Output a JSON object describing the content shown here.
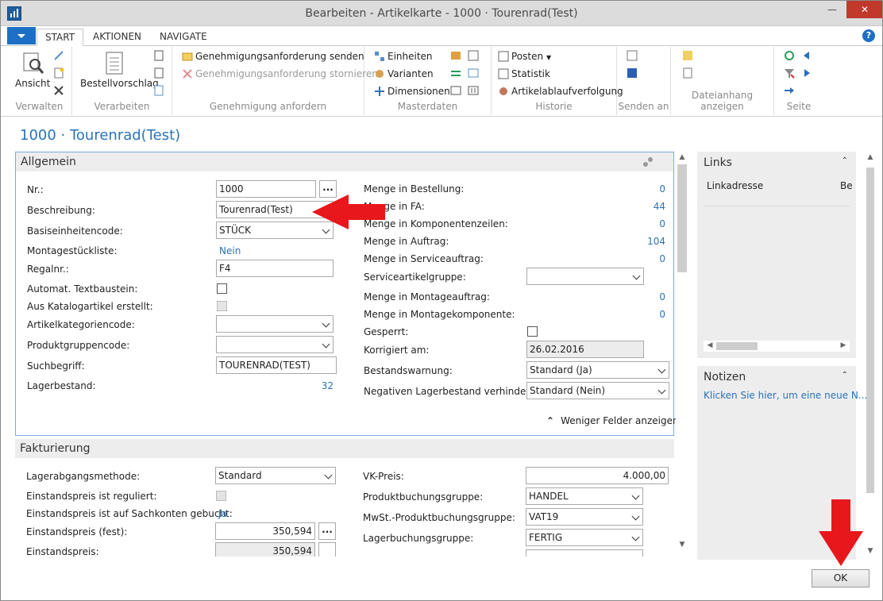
{
  "window": {
    "title": "Bearbeiten - Artikelkarte - 1000 · Tourenrad(Test)",
    "minimize_glyph": "—",
    "close_glyph": "✕"
  },
  "ribbon": {
    "tabs": [
      "START",
      "AKTIONEN",
      "NAVIGATE"
    ],
    "help_glyph": "?",
    "groups": {
      "verwalten": {
        "label": "Verwalten",
        "ansicht": "Ansicht"
      },
      "verarbeiten": {
        "label": "Verarbeiten",
        "bestellvorschlag": "Bestellvorschlag"
      },
      "genehmigung": {
        "label": "Genehmigung anfordern",
        "senden": "Genehmigungsanforderung senden",
        "stornieren": "Genehmigungsanforderung stornieren"
      },
      "masterdaten": {
        "label": "Masterdaten",
        "einheiten": "Einheiten",
        "varianten": "Varianten",
        "dimensionen": "Dimensionen"
      },
      "historie": {
        "label": "Historie",
        "posten": "Posten",
        "statistik": "Statistik",
        "artikelablauf": "Artikelablaufverfolgung"
      },
      "senden": {
        "label": "Senden an"
      },
      "dateianhang": {
        "label": "Dateianhang anzeigen"
      },
      "seite": {
        "label": "Seite"
      }
    }
  },
  "page_title": "1000 · Tourenrad(Test)",
  "allgemein": {
    "title": "Allgemein",
    "left": {
      "nr_label": "Nr.:",
      "nr_value": "1000",
      "dots": "...",
      "beschreibung_label": "Beschreibung:",
      "beschreibung_value": "Tourenrad(Test)",
      "basiseinheit_label": "Basiseinheitencode:",
      "basiseinheit_value": "STÜCK",
      "montage_label": "Montagestückliste:",
      "montage_value": "Nein",
      "regal_label": "Regalnr.:",
      "regal_value": "F4",
      "textbaustein_label": "Automat. Textbaustein:",
      "katalog_label": "Aus Katalogartikel erstellt:",
      "kategorie_label": "Artikelkategoriencode:",
      "produktgruppe_label": "Produktgruppencode:",
      "suchbegriff_label": "Suchbegriff:",
      "suchbegriff_value": "TOURENRAD(TEST)",
      "lagerbestand_label": "Lagerbestand:",
      "lagerbestand_value": "32"
    },
    "right": {
      "bestellung_label": "Menge in Bestellung:",
      "bestellung_value": "0",
      "fa_label": "Menge in FA:",
      "fa_value": "44",
      "komponenten_label": "Menge in Komponentenzeilen:",
      "komponenten_value": "0",
      "auftrag_label": "Menge in Auftrag:",
      "auftrag_value": "104",
      "service_label": "Menge in Serviceauftrag:",
      "service_value": "0",
      "servicegruppe_label": "Serviceartikelgruppe:",
      "montageauftrag_label": "Menge in Montageauftrag:",
      "montageauftrag_value": "0",
      "montagekomp_label": "Menge in Montagekomponente:",
      "montagekomp_value": "0",
      "gesperrt_label": "Gesperrt:",
      "korrigiert_label": "Korrigiert am:",
      "korrigiert_value": "26.02.2016",
      "warnung_label": "Bestandswarnung:",
      "warnung_value": "Standard (Ja)",
      "negativ_label": "Negativen Lagerbestand verhindern:",
      "negativ_value": "Standard (Nein)"
    },
    "fewer_fields": "Weniger Felder anzeigen",
    "fewer_glyph": "⌃",
    "collapse_glyph": "⌃"
  },
  "fakturierung": {
    "title": "Fakturierung",
    "left": {
      "methode_label": "Lagerabgangsmethode:",
      "methode_value": "Standard",
      "reguliert_label": "Einstandspreis ist reguliert:",
      "sachkonten_label": "Einstandspreis ist auf Sachkonten gebucht:",
      "sachkonten_value": "Ja",
      "fest_label": "Einstandspreis (fest):",
      "fest_value": "350,594",
      "ep_label": "Einstandspreis:",
      "ep_value": "350,594"
    },
    "right": {
      "vk_label": "VK-Preis:",
      "vk_value": "4.000,00",
      "prodbuch_label": "Produktbuchungsgruppe:",
      "prodbuch_value": "HANDEL",
      "mwst_label": "MwSt.-Produktbuchungsgruppe:",
      "mwst_value": "VAT19",
      "lagerbuch_label": "Lagerbuchungsgruppe:",
      "lagerbuch_value": "FERTIG"
    }
  },
  "factbox": {
    "links_title": "Links",
    "links_column": "Linkadresse",
    "links_column2": "Be",
    "notes_title": "Notizen",
    "notes_link": "Klicken Sie hier, um eine neue N...",
    "caret": "⌃"
  },
  "scroll": {
    "up": "▲",
    "down": "▼",
    "left": "◀",
    "right": "▶"
  },
  "ok_label": "OK",
  "colors": {
    "accent": "#2a73b8",
    "arrow": "#e8171b",
    "close": "#c0392b"
  }
}
